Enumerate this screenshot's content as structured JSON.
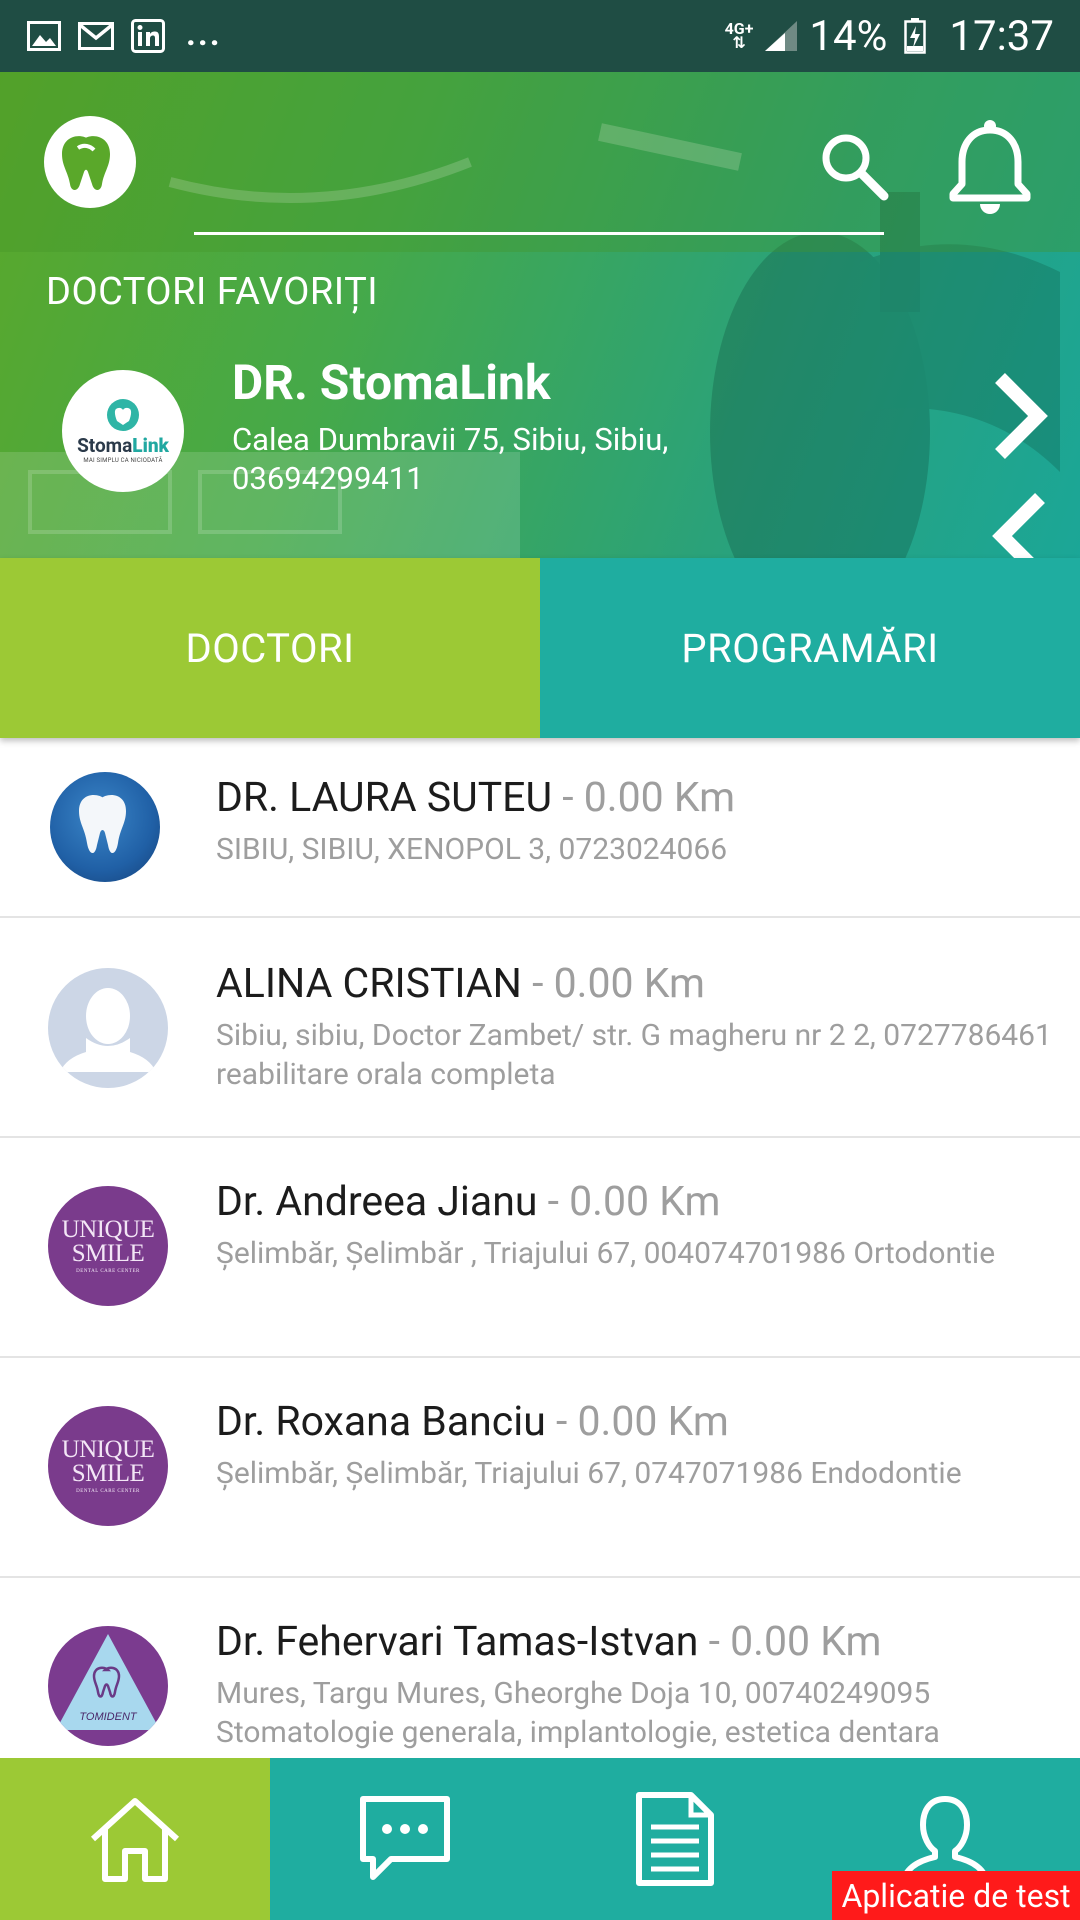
{
  "status_bar": {
    "network": "4G+",
    "battery": "14%",
    "time": "17:37",
    "more": "..."
  },
  "header": {
    "search_placeholder": "",
    "favorites_title": "DOCTORI FAVORIȚI",
    "favorite": {
      "name": "DR. StomaLink",
      "address": "Calea Dumbravii 75, Sibiu, Sibiu, 03694299411",
      "logo_brand_a": "Stoma",
      "logo_brand_b": "Link",
      "logo_tagline": "MAI SIMPLU CA NICIODATĂ"
    }
  },
  "tabs": {
    "doctori": "DOCTORI",
    "programari": "PROGRAMĂRI"
  },
  "doctors": [
    {
      "name": "DR. LAURA SUTEU",
      "distance": " - 0.00 Km",
      "details": "SIBIU, SIBIU, XENOPOL 3, 0723024066",
      "avatar": "tooth-icon"
    },
    {
      "name": "ALINA CRISTIAN",
      "distance": " - 0.00 Km",
      "details": "Sibiu, sibiu, Doctor Zambet/ str. G magheru nr 2 2, 0727786461 reabilitare orala completa",
      "avatar": "person-icon"
    },
    {
      "name": "Dr. Andreea Jianu",
      "distance": " - 0.00 Km",
      "details": "Șelimbăr, Șelimbăr , Triajului 67, 004074701986 Ortodontie",
      "avatar": "unique-smile-logo"
    },
    {
      "name": "Dr. Roxana Banciu",
      "distance": " - 0.00 Km",
      "details": "Șelimbăr, Șelimbăr, Triajului 67, 0747071986 Endodontie",
      "avatar": "unique-smile-logo"
    },
    {
      "name": "Dr. Fehervari Tamas-Istvan",
      "distance": " - 0.00 Km",
      "details": "Mures, Targu Mures, Gheorghe Doja 10, 00740249095 Stomatologie generala, implantologie, estetica dentara",
      "avatar": "tomident-logo"
    }
  ],
  "logos": {
    "unique_line1": "UNIQUE",
    "unique_line2": "SMILE",
    "unique_line3": "DENTAL CARE CENTER",
    "tomident": "TOMIDENT"
  },
  "bottom_nav": [
    "home-icon",
    "chat-icon",
    "document-icon",
    "profile-icon"
  ],
  "test_badge": "Aplicatie de test",
  "colors": {
    "status_bar": "#1f4d44",
    "green": "#9cc935",
    "teal": "#1fada0",
    "badge": "#ff1a1a"
  }
}
